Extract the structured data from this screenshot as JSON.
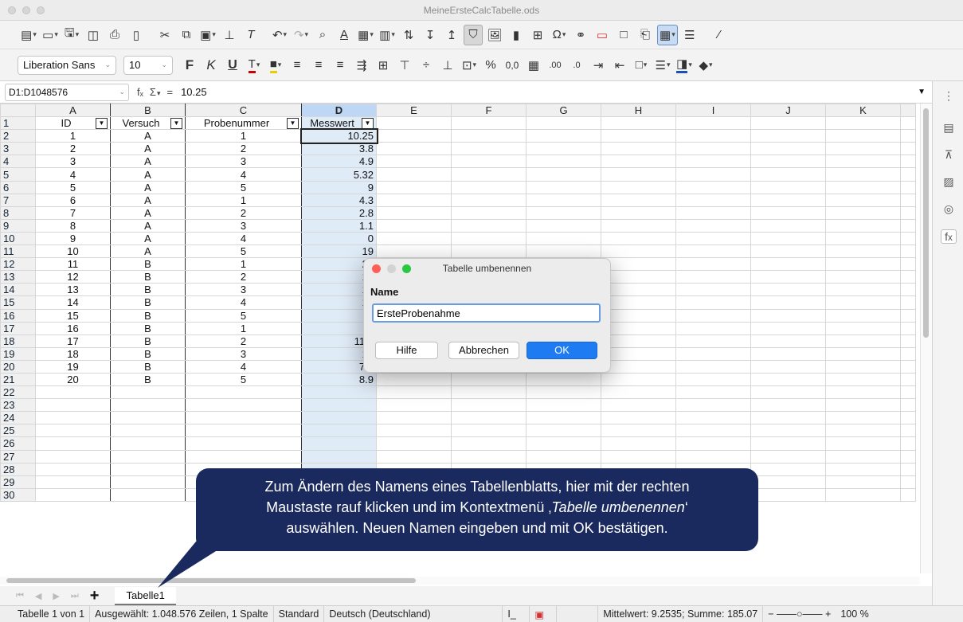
{
  "window": {
    "title": "MeineErsteCalcTabelle.ods"
  },
  "toolbar": {
    "icons": [
      "new-document",
      "template",
      "save",
      "open-remote",
      "print",
      "print-preview",
      "cut",
      "copy",
      "paste",
      "clone-formatting",
      "clear-formatting",
      "undo",
      "redo",
      "find-replace",
      "spelling",
      "row",
      "column",
      "sort-ascending",
      "sort-descending",
      "sort",
      "autofilter",
      "image",
      "chart",
      "pivot-table",
      "special-character",
      "hyperlink",
      "comment",
      "headers-footers",
      "define-print-area",
      "freeze-rows-columns",
      "split-window",
      "sidebar-toggle"
    ]
  },
  "format": {
    "font_name": "Liberation Sans",
    "font_size": "10",
    "bold_label": "F",
    "italic_label": "K",
    "underline_label": "U",
    "percent_label": "%",
    "number_label": "0,0"
  },
  "formula_bar": {
    "name_box": "D1:D1048576",
    "function_wizard": "fₓ",
    "sum_label": "Σ",
    "equals": "=",
    "value": "10.25"
  },
  "sheet": {
    "columns": [
      "A",
      "B",
      "C",
      "D",
      "E",
      "F",
      "G",
      "H",
      "I",
      "J",
      "K"
    ],
    "header_row": {
      "A": "ID",
      "B": "Versuch",
      "C": "Probenummer",
      "D": "Messwert"
    },
    "rows": [
      {
        "n": "1"
      },
      {
        "n": "2",
        "a": "1",
        "b": "A",
        "c": "1",
        "d": "10.25"
      },
      {
        "n": "3",
        "a": "2",
        "b": "A",
        "c": "2",
        "d": "3.8"
      },
      {
        "n": "4",
        "a": "3",
        "b": "A",
        "c": "3",
        "d": "4.9"
      },
      {
        "n": "5",
        "a": "4",
        "b": "A",
        "c": "4",
        "d": "5.32"
      },
      {
        "n": "6",
        "a": "5",
        "b": "A",
        "c": "5",
        "d": "9"
      },
      {
        "n": "7",
        "a": "6",
        "b": "A",
        "c": "1",
        "d": "4.3"
      },
      {
        "n": "8",
        "a": "7",
        "b": "A",
        "c": "2",
        "d": "2.8"
      },
      {
        "n": "9",
        "a": "8",
        "b": "A",
        "c": "3",
        "d": "1.1"
      },
      {
        "n": "10",
        "a": "9",
        "b": "A",
        "c": "4",
        "d": "0"
      },
      {
        "n": "11",
        "a": "10",
        "b": "A",
        "c": "5",
        "d": "19"
      },
      {
        "n": "12",
        "a": "11",
        "b": "B",
        "c": "1",
        "d": "20"
      },
      {
        "n": "13",
        "a": "12",
        "b": "B",
        "c": "2",
        "d": "17"
      },
      {
        "n": "14",
        "a": "13",
        "b": "B",
        "c": "3",
        "d": "12"
      },
      {
        "n": "15",
        "a": "14",
        "b": "B",
        "c": "4",
        "d": "14"
      },
      {
        "n": "16",
        "a": "15",
        "b": "B",
        "c": "5",
        "d": "9"
      },
      {
        "n": "17",
        "a": "16",
        "b": "B",
        "c": "1",
        "d": "8."
      },
      {
        "n": "18",
        "a": "17",
        "b": "B",
        "c": "2",
        "d": "11.4"
      },
      {
        "n": "19",
        "a": "18",
        "b": "B",
        "c": "3",
        "d": "13"
      },
      {
        "n": "20",
        "a": "19",
        "b": "B",
        "c": "4",
        "d": "7.8"
      },
      {
        "n": "21",
        "a": "20",
        "b": "B",
        "c": "5",
        "d": "8.9"
      },
      {
        "n": "22"
      },
      {
        "n": "23"
      },
      {
        "n": "24"
      },
      {
        "n": "25"
      },
      {
        "n": "26"
      },
      {
        "n": "27"
      },
      {
        "n": "28"
      },
      {
        "n": "29"
      },
      {
        "n": "30"
      }
    ]
  },
  "tabs": {
    "sheet_name": "Tabelle1",
    "add": "+"
  },
  "status": {
    "sheet_pos": "Tabelle 1 von 1",
    "selection": "Ausgewählt: 1.048.576 Zeilen, 1 Spalte",
    "page_style": "Standard",
    "language": "Deutsch (Deutschland)",
    "stats": "Mittelwert: 9.2535; Summe: 185.07",
    "zoom": "100 %"
  },
  "dialog": {
    "title": "Tabelle umbenennen",
    "label": "Name",
    "value": "ErsteProbenahme",
    "help": "Hilfe",
    "cancel": "Abbrechen",
    "ok": "OK"
  },
  "callout": {
    "line1": "Zum Ändern des Namens eines Tabellenblatts, hier mit der rechten",
    "line2_pre": "Maustaste rauf klicken und im Kontextmenü ‚",
    "line2_em": "Tabelle umbenennen",
    "line2_post": "‘",
    "line3": "auswählen. Neuen Namen eingeben und mit OK bestätigen."
  },
  "colors": {
    "accent": "#1e7bf2",
    "selection": "#bdd7f4",
    "callout_bg": "#1b2a5e"
  }
}
